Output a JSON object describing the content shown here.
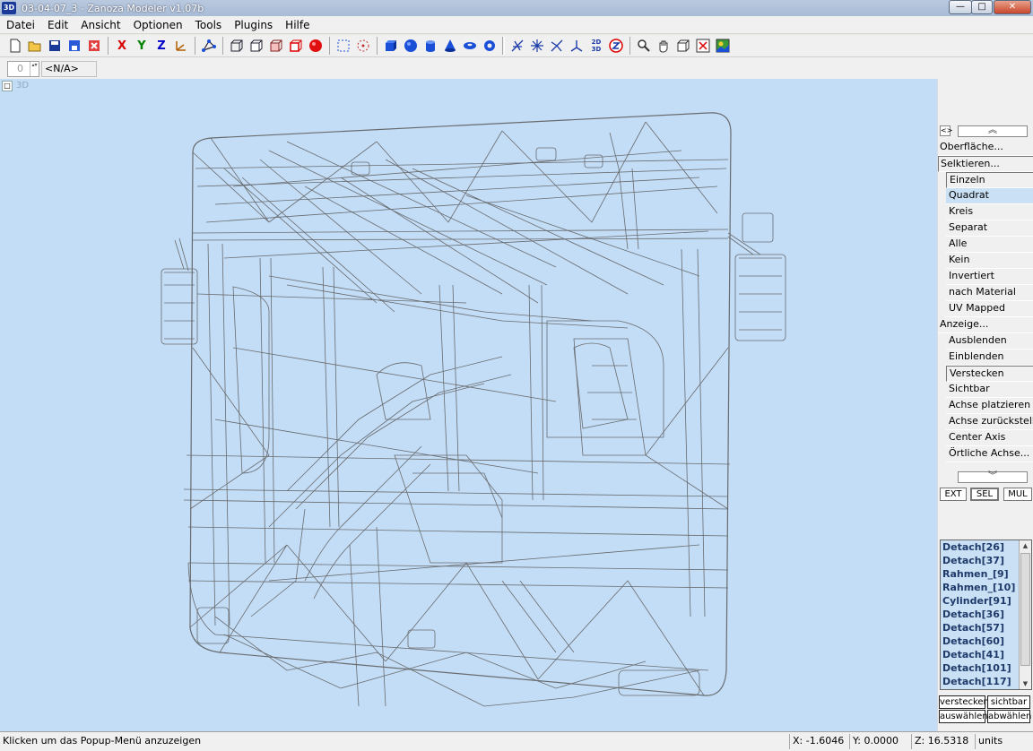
{
  "window": {
    "title": "03-04-07_3 - Zanoza Modeler v1.07b",
    "icon_label": "3D",
    "minimize": "—",
    "maximize": "□",
    "close": "✕"
  },
  "menu": [
    "Datei",
    "Edit",
    "Ansicht",
    "Optionen",
    "Tools",
    "Plugins",
    "Hilfe"
  ],
  "toolbar": {
    "icons": [
      "new-file-icon",
      "open-folder-icon",
      "save-icon",
      "save-as-icon",
      "revert-icon",
      "x-axis-icon",
      "y-axis-icon",
      "z-axis-icon",
      "axes-icon",
      "vertex-mode-icon",
      "box-wire-icon",
      "box-icon",
      "box-shaded-icon",
      "box-red-icon",
      "sphere-red-icon",
      "select-rect-icon",
      "select-circle-icon",
      "cube-icon",
      "sphere-icon",
      "cylinder-icon",
      "cone-icon",
      "torus-icon",
      "ring-icon",
      "move-icon",
      "rotate-icon",
      "scale-icon",
      "axis-tool-icon",
      "2d-3d-icon",
      "z-lock-icon",
      "zoom-icon",
      "pan-icon",
      "view-cube-icon",
      "render-icon",
      "texture-icon"
    ],
    "letters": {
      "x": "X",
      "y": "Y",
      "z": "Z",
      "twod": "2D 3D"
    },
    "colors": {
      "x": "#d80000",
      "y": "#008000",
      "z": "#0000c8",
      "accent": "#1a4fd8",
      "red": "#e01010"
    }
  },
  "subbar": {
    "spin_value": "0",
    "spin_arrows": "▴▾",
    "selection": "<N/A>"
  },
  "viewport": {
    "background": "#c3ddf7",
    "view_label": "3D",
    "corner": "□",
    "wire_color": "#5a5a5a"
  },
  "panel": {
    "toggle": "<>",
    "scroll_up": "︽",
    "scroll_down": "︾",
    "sections": {
      "oberflaeche": "Oberfläche...",
      "selektieren": "Selktieren...",
      "anzeige": "Anzeige..."
    },
    "select_items": [
      "Einzeln",
      "Quadrat",
      "Kreis",
      "Separat",
      "Alle",
      "Kein",
      "Invertiert",
      "nach Material",
      "UV Mapped"
    ],
    "selected_item": "Quadrat",
    "display_items": [
      "Ausblenden",
      "Einblenden",
      "Verstecken",
      "Sichtbar",
      "Achse platzieren",
      "Achse zurückstellen",
      "Center Axis",
      "Örtliche Achse..."
    ],
    "tabs": {
      "ext": "EXT",
      "sel": "SEL",
      "mul": "MUL"
    }
  },
  "objects": [
    "Detach[26]",
    "Detach[37]",
    "Rahmen_[9]",
    "Rahmen_[10]",
    "Cylinder[91]",
    "Detach[36]",
    "Detach[57]",
    "Detach[60]",
    "Detach[41]",
    "Detach[101]",
    "Detach[117]"
  ],
  "object_buttons": {
    "verstecken": "verstecken",
    "sichtbar": "sichtbar",
    "auswaehlen": "auswählen",
    "abwaehlen": "abwählen"
  },
  "status": {
    "message": "Klicken um das Popup-Menü anzuzeigen",
    "x": "X: -1.6046",
    "y": "Y: 0.0000",
    "z": "Z: 16.5318",
    "units": "units"
  }
}
